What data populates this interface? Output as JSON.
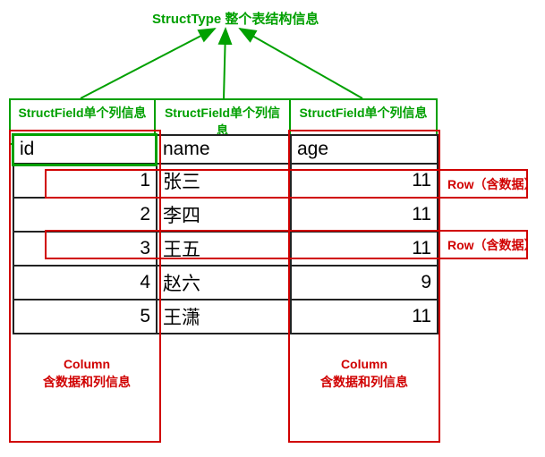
{
  "structtype_label": "StructType 整个表结构信息",
  "structfields": [
    "StructField单个列信息",
    "StructField单个列信息",
    "StructField单个列信息"
  ],
  "headers": {
    "id": "id",
    "name": "name",
    "age": "age"
  },
  "chart_data": {
    "type": "table",
    "columns": [
      "id",
      "name",
      "age"
    ],
    "rows": [
      {
        "id": 1,
        "name": "张三",
        "age": 11
      },
      {
        "id": 2,
        "name": "李四",
        "age": 11
      },
      {
        "id": 3,
        "name": "王五",
        "age": 11
      },
      {
        "id": 4,
        "name": "赵六",
        "age": 9
      },
      {
        "id": 5,
        "name": "王潇",
        "age": 11
      }
    ]
  },
  "row_annotation": "Row（含数据）",
  "column_annotation_title": "Column",
  "column_annotation_sub": "含数据和列信息"
}
